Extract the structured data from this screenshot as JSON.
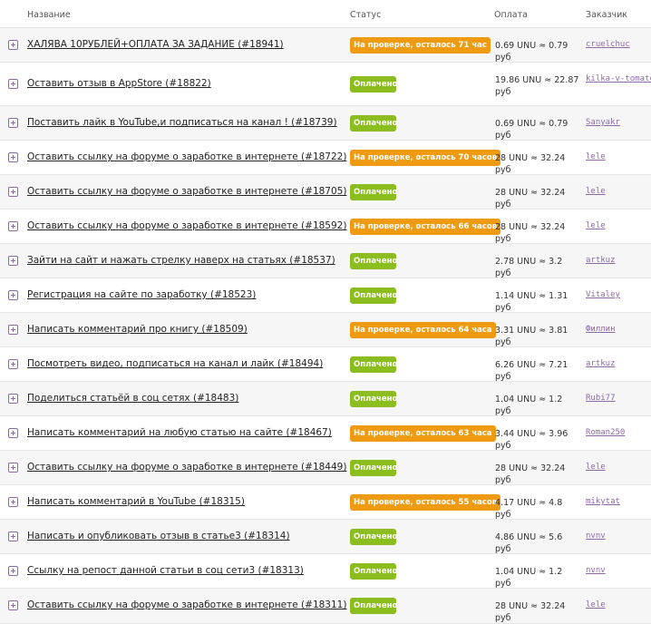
{
  "header": {
    "name": "Название",
    "status": "Статус",
    "payment": "Оплата",
    "customer": "Заказчик"
  },
  "colors": {
    "paid": "#8bbd1f",
    "review": "#ef9b12",
    "link": "#8e6aa6"
  },
  "rows": [
    {
      "title": "ХАЛЯВА 10РУБЛЕЙ+ОПЛАТА ЗА ЗАДАНИЕ (#18941)",
      "status": "На проверке, осталось 71 час",
      "status_type": "review",
      "payment": "0.69 UNU ≈ 0.79 руб",
      "customer": "cruelchuc"
    },
    {
      "title": "Оставить отзыв в AppStore (#18822)",
      "status": "Оплачено",
      "status_type": "paid",
      "payment": "19.86 UNU ≈ 22.87 руб",
      "customer": "kilka-v-tomate"
    },
    {
      "title": "Поставить лайк в YouTube,и подписаться на канал ! (#18739)",
      "status": "Оплачено",
      "status_type": "paid",
      "payment": "0.69 UNU ≈ 0.79 руб",
      "customer": "Sanyakr"
    },
    {
      "title": "Оставить ссылку на форуме о заработке в интернете (#18722)",
      "status": "На проверке, осталось 70 часов",
      "status_type": "review",
      "payment": "28 UNU ≈ 32.24 руб",
      "customer": "lele"
    },
    {
      "title": "Оставить ссылку на форуме о заработке в интернете (#18705)",
      "status": "Оплачено",
      "status_type": "paid",
      "payment": "28 UNU ≈ 32.24 руб",
      "customer": "lele"
    },
    {
      "title": "Оставить ссылку на форуме о заработке в интернете (#18592)",
      "status": "На проверке, осталось 66 часов",
      "status_type": "review",
      "payment": "28 UNU ≈ 32.24 руб",
      "customer": "lele"
    },
    {
      "title": "Зайти на сайт и нажать стрелку наверх на статьях (#18537)",
      "status": "Оплачено",
      "status_type": "paid",
      "payment": "2.78 UNU ≈ 3.2 руб",
      "customer": "artkuz"
    },
    {
      "title": "Регистрация на сайте по заработку (#18523)",
      "status": "Оплачено",
      "status_type": "paid",
      "payment": "1.14 UNU ≈ 1.31 руб",
      "customer": "Vitaley"
    },
    {
      "title": "Написать комментарий про книгу (#18509)",
      "status": "На проверке, осталось 64 часа",
      "status_type": "review",
      "payment": "3.31 UNU ≈ 3.81 руб",
      "customer": "Филлин"
    },
    {
      "title": "Посмотреть видео, подписаться на канал и лайк (#18494)",
      "status": "Оплачено",
      "status_type": "paid",
      "payment": "6.26 UNU ≈ 7.21 руб",
      "customer": "artkuz"
    },
    {
      "title": "Поделиться статьёй в соц сетях (#18483)",
      "status": "Оплачено",
      "status_type": "paid",
      "payment": "1.04 UNU ≈ 1.2 руб",
      "customer": "Rubi77"
    },
    {
      "title": "Написать комментарий на любую статью на сайте (#18467)",
      "status": "На проверке, осталось 63 часа",
      "status_type": "review",
      "payment": "3.44 UNU ≈ 3.96 руб",
      "customer": "Roman250"
    },
    {
      "title": "Оставить ссылку на форуме о заработке в интернете (#18449)",
      "status": "Оплачено",
      "status_type": "paid",
      "payment": "28 UNU ≈ 32.24 руб",
      "customer": "lele"
    },
    {
      "title": "Написать комментарий в YouTube (#18315)",
      "status": "На проверке, осталось 55 часов",
      "status_type": "review",
      "payment": "4.17 UNU ≈ 4.8 руб",
      "customer": "mikytat"
    },
    {
      "title": "Написать и опубликовать отзыв в статье3 (#18314)",
      "status": "Оплачено",
      "status_type": "paid",
      "payment": "4.86 UNU ≈ 5.6 руб",
      "customer": "nvnv"
    },
    {
      "title": "Ссылку на репост данной статьи в соц сети3 (#18313)",
      "status": "Оплачено",
      "status_type": "paid",
      "payment": "1.04 UNU ≈ 1.2 руб",
      "customer": "nvnv"
    },
    {
      "title": "Оставить ссылку на форуме о заработке в интернете (#18311)",
      "status": "Оплачено",
      "status_type": "paid",
      "payment": "28 UNU ≈ 32.24 руб",
      "customer": "lele"
    }
  ]
}
